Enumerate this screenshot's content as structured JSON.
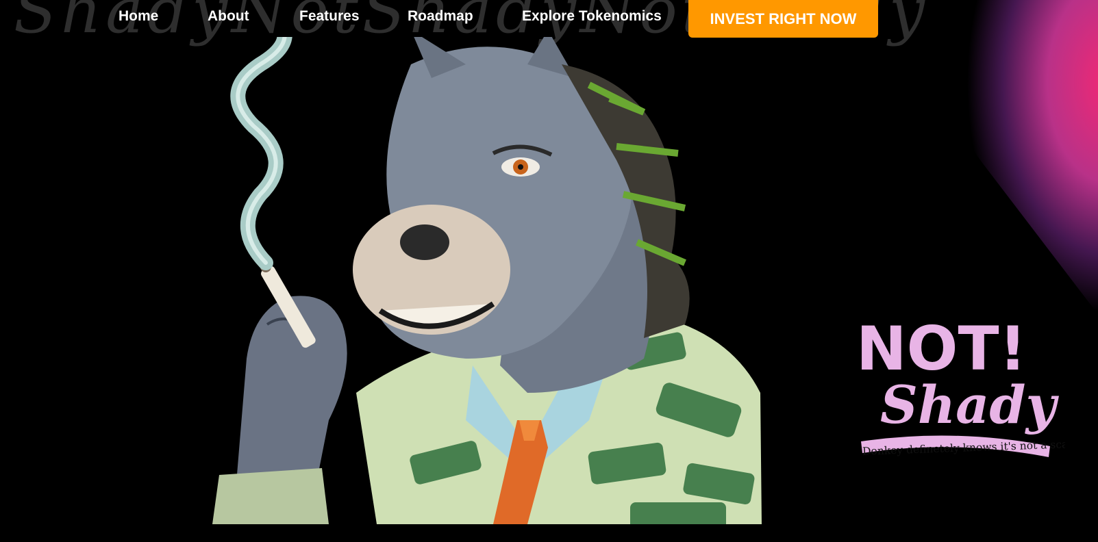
{
  "nav": {
    "links": [
      "Home",
      "About",
      "Features",
      "Roadmap",
      "Explore Tokenomics"
    ],
    "cta": "INVEST RIGHT NOW"
  },
  "badge": {
    "title_line1": "NOT!",
    "title_line2": "Shady",
    "tagline": "Donkey definetely knows  it's not a scam"
  },
  "colors": {
    "accent": "#ff9800",
    "badge": "#e8b4e6",
    "glow": "#ff2a7a"
  }
}
